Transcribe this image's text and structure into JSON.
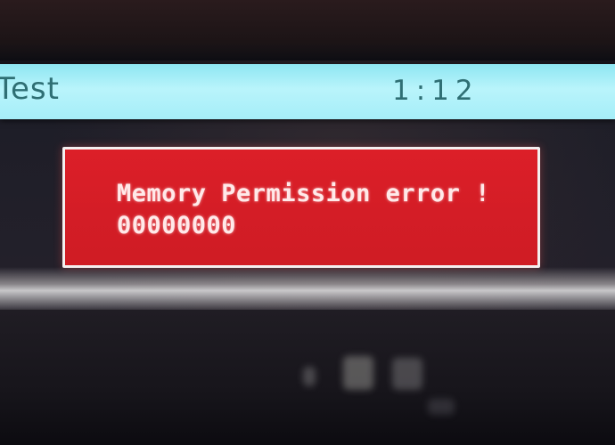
{
  "title_bar": {
    "title": "Test",
    "clock": "1:12"
  },
  "error_dialog": {
    "message": "Memory Permission error !",
    "code": "00000000"
  }
}
